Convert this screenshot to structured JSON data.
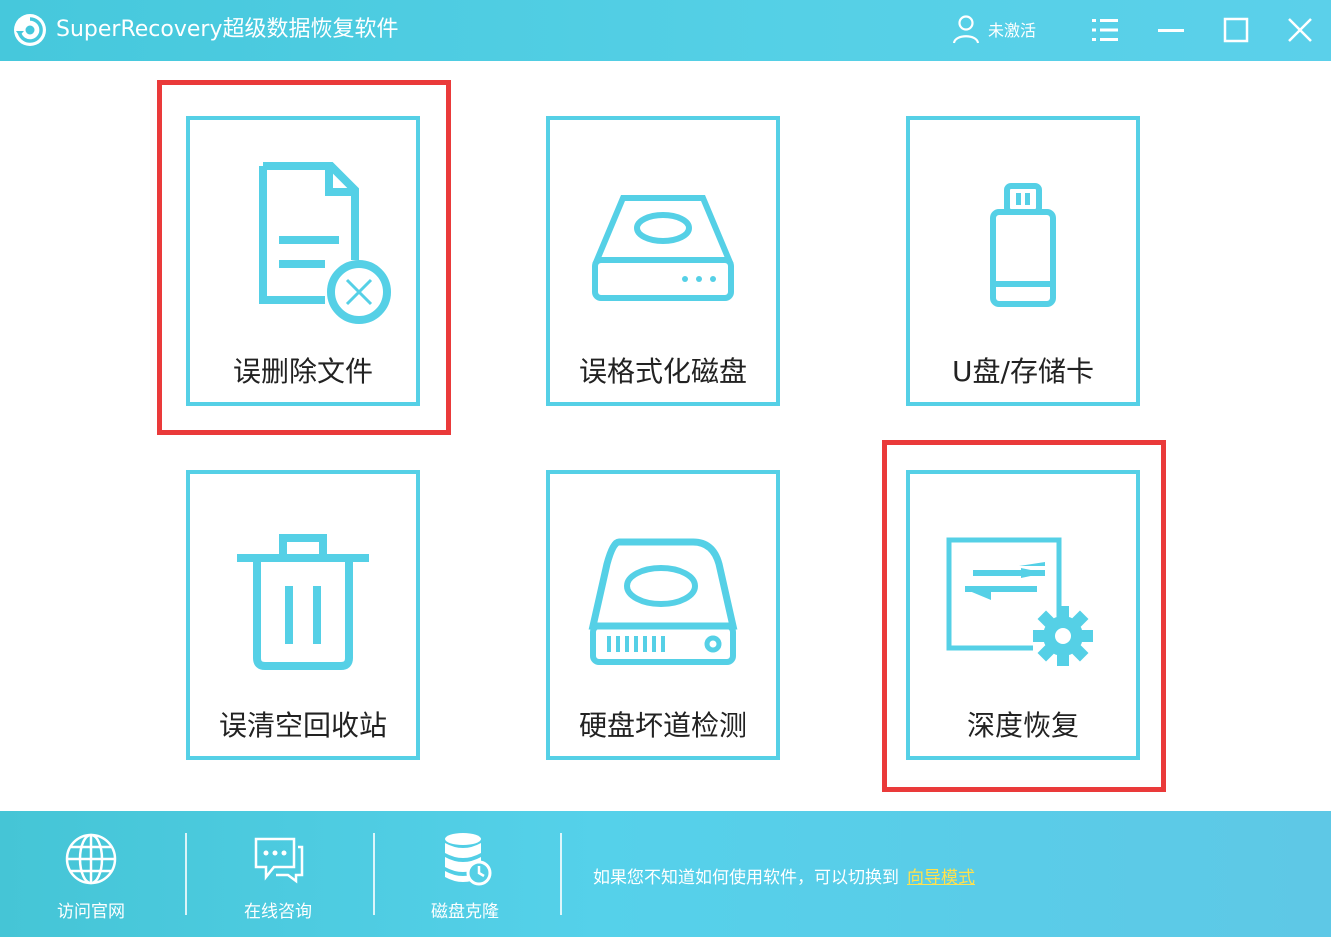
{
  "titlebar": {
    "title": "SuperRecovery超级数据恢复软件",
    "logo_icon": "recovery-logo-icon",
    "user_status": "未激活",
    "buttons": [
      "menu-icon",
      "minimize-icon",
      "maximize-icon",
      "close-icon"
    ]
  },
  "tiles": [
    {
      "label": "误删除文件",
      "icon": "deleted-file-icon"
    },
    {
      "label": "误格式化磁盘",
      "icon": "disk-icon"
    },
    {
      "label": "U盘/存储卡",
      "icon": "usb-drive-icon"
    },
    {
      "label": "误清空回收站",
      "icon": "trash-bin-icon"
    },
    {
      "label": "硬盘坏道检测",
      "icon": "hard-drive-icon"
    },
    {
      "label": "深度恢复",
      "icon": "deep-recovery-icon"
    }
  ],
  "footer": {
    "items": [
      {
        "label": "访问官网",
        "icon": "globe-icon"
      },
      {
        "label": "在线咨询",
        "icon": "chat-icon"
      },
      {
        "label": "磁盘克隆",
        "icon": "database-clone-icon"
      }
    ],
    "hint": "如果您不知道如何使用软件，可以切换到",
    "guide_link": "向导模式"
  },
  "colors": {
    "accent": "#55d0e6",
    "highlight": "#ea3a3a",
    "link": "#ffe14d"
  }
}
